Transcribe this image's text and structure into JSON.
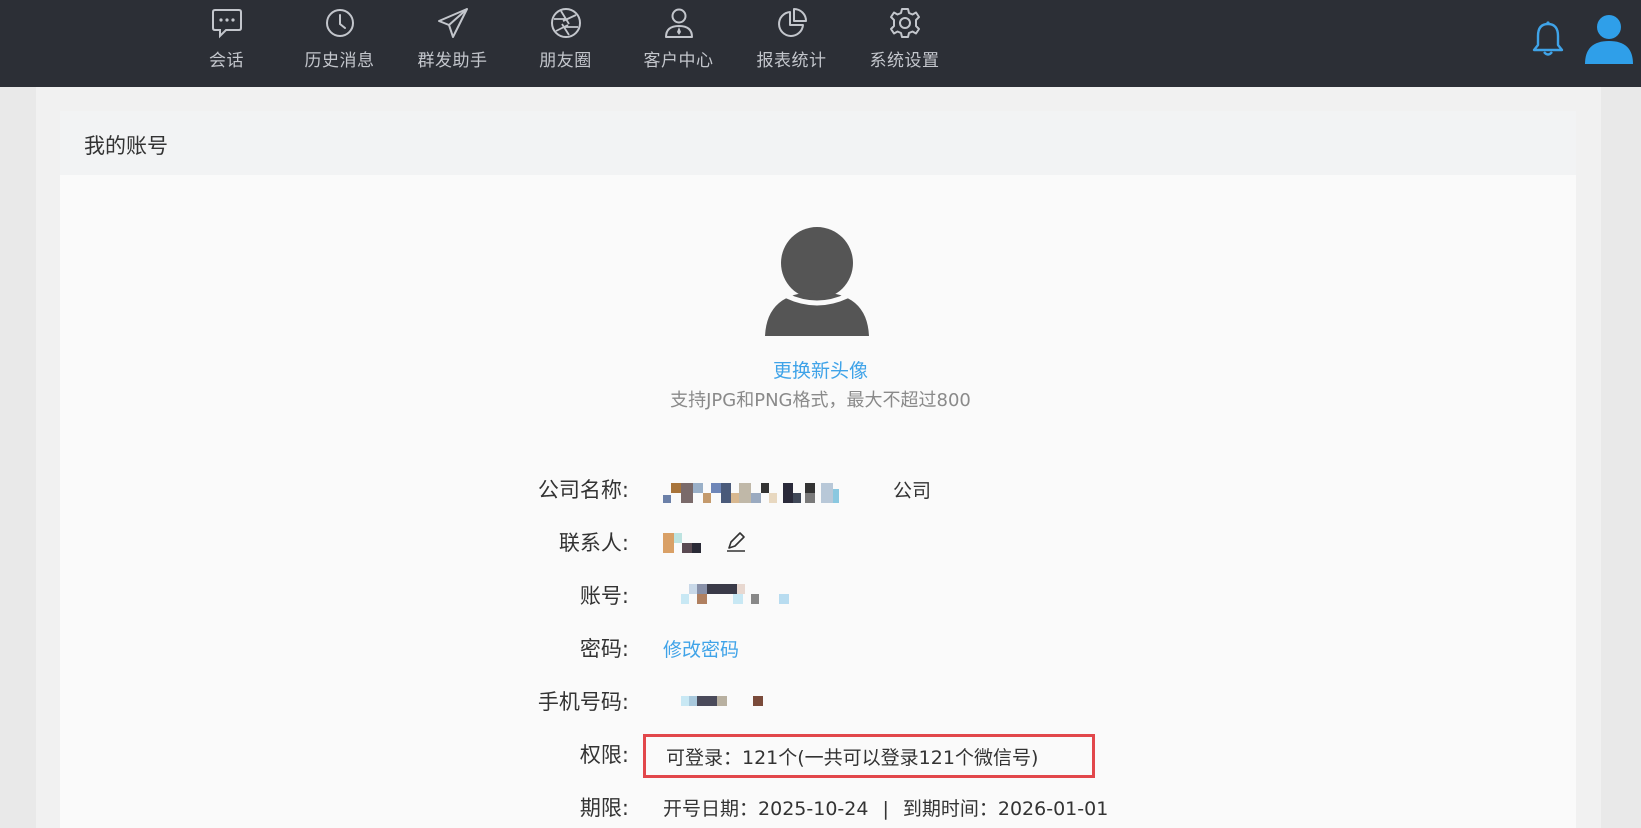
{
  "nav": {
    "items": [
      {
        "label": "会话",
        "icon": "chat-icon"
      },
      {
        "label": "历史消息",
        "icon": "clock-icon"
      },
      {
        "label": "群发助手",
        "icon": "paper-plane-icon"
      },
      {
        "label": "朋友圈",
        "icon": "aperture-icon"
      },
      {
        "label": "客户中心",
        "icon": "person-tie-icon"
      },
      {
        "label": "报表统计",
        "icon": "pie-chart-icon"
      },
      {
        "label": "系统设置",
        "icon": "gear-icon"
      }
    ],
    "notification_icon": "bell-icon",
    "user_icon": "user-avatar-icon",
    "accent_color": "#3fa3e8"
  },
  "card": {
    "title": "我的账号"
  },
  "avatar": {
    "change_label": "更换新头像",
    "hint": "支持JPG和PNG格式，最大不超过800"
  },
  "fields": {
    "company": {
      "label": "公司名称:",
      "suffix": "公司"
    },
    "contact": {
      "label": "联系人:"
    },
    "account": {
      "label": "账号:"
    },
    "password": {
      "label": "密码:",
      "link": "修改密码"
    },
    "phone": {
      "label": "手机号码:"
    },
    "permission": {
      "label": "权限:",
      "value": "可登录：121个(一共可以登录121个微信号)",
      "highlight_color": "#e2474b"
    },
    "period": {
      "label": "期限:",
      "start_label": "开号日期：",
      "start_date": "2025-10-24",
      "separator": "|",
      "end_label": "到期时间：",
      "end_date": "2026-01-01"
    }
  }
}
